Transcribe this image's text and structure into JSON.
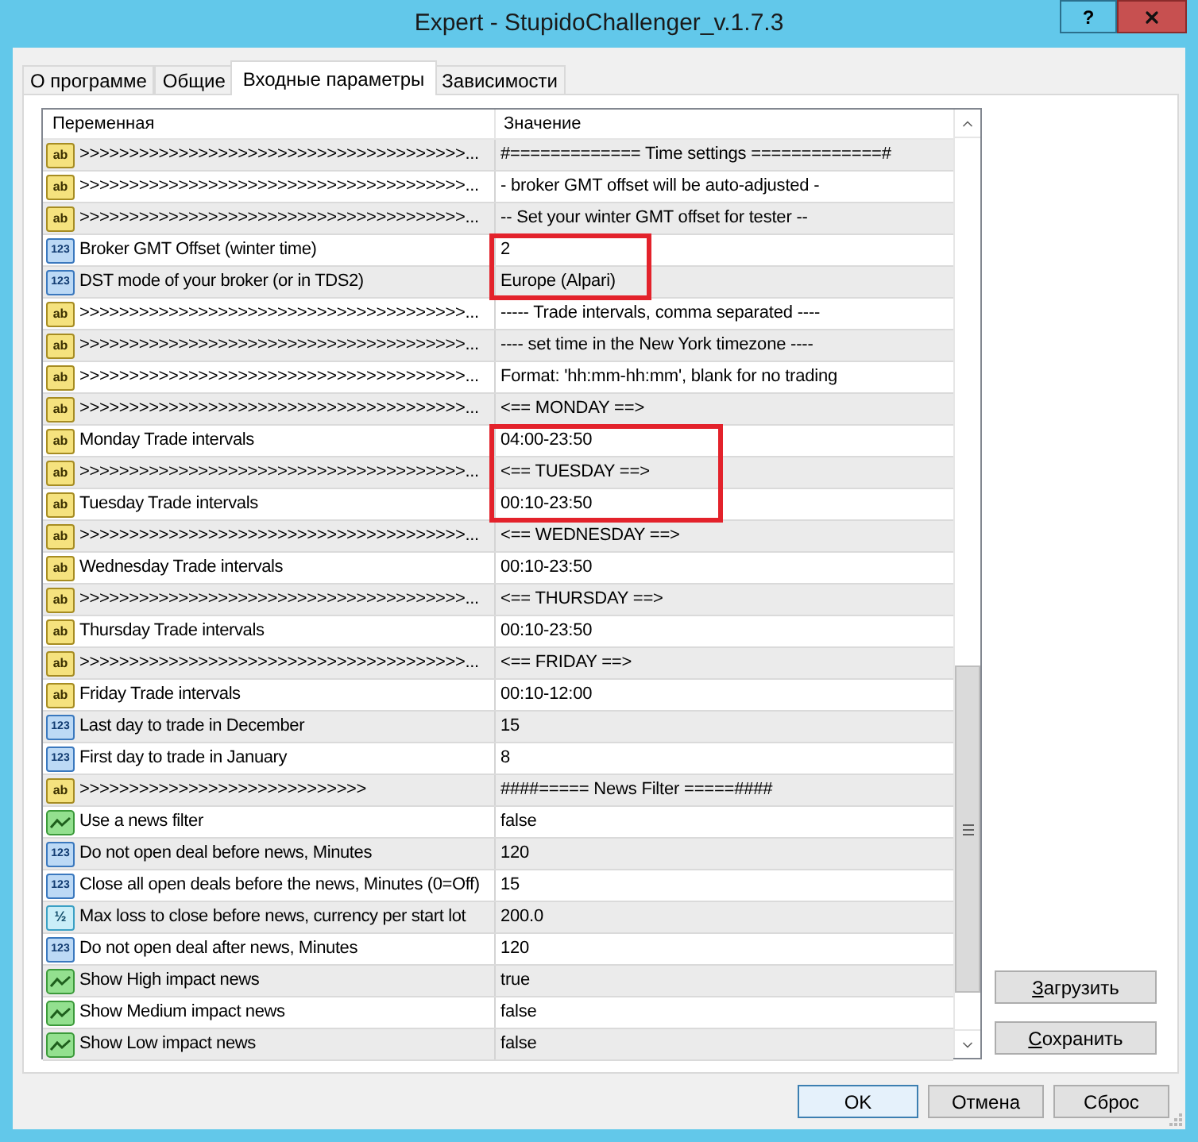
{
  "window": {
    "title": "Expert - StupidoChallenger_v.1.7.3",
    "help_button": "?"
  },
  "tabs": [
    {
      "label": "О программе",
      "selected": false
    },
    {
      "label": "Общие",
      "selected": false
    },
    {
      "label": "Входные параметры",
      "selected": true
    },
    {
      "label": "Зависимости",
      "selected": false
    }
  ],
  "table": {
    "columns": [
      "Переменная",
      "Значение"
    ],
    "rows": [
      {
        "kind": "string",
        "type_label": "ab",
        "name": ">>>>>>>>>>>>>>>>>>>>>>>>>>>>>>>>>>>>>>>...",
        "value": "#============= Time settings =============#",
        "highlighted": false
      },
      {
        "kind": "string",
        "type_label": "ab",
        "name": ">>>>>>>>>>>>>>>>>>>>>>>>>>>>>>>>>>>>>>>...",
        "value": "- broker GMT offset will be auto-adjusted -",
        "highlighted": false
      },
      {
        "kind": "string",
        "type_label": "ab",
        "name": ">>>>>>>>>>>>>>>>>>>>>>>>>>>>>>>>>>>>>>>...",
        "value": "-- Set your winter GMT offset for tester --",
        "highlighted": false
      },
      {
        "kind": "int",
        "type_label": "123",
        "name": "Broker GMT Offset (winter time)",
        "value": "2",
        "highlighted": true
      },
      {
        "kind": "int",
        "type_label": "123",
        "name": "DST mode of your broker (or in TDS2)",
        "value": "Europe (Alpari)",
        "highlighted": true
      },
      {
        "kind": "string",
        "type_label": "ab",
        "name": ">>>>>>>>>>>>>>>>>>>>>>>>>>>>>>>>>>>>>>>...",
        "value": "----- Trade intervals, comma separated ----",
        "highlighted": false
      },
      {
        "kind": "string",
        "type_label": "ab",
        "name": ">>>>>>>>>>>>>>>>>>>>>>>>>>>>>>>>>>>>>>>...",
        "value": "---- set time in the New York timezone ----",
        "highlighted": false
      },
      {
        "kind": "string",
        "type_label": "ab",
        "name": ">>>>>>>>>>>>>>>>>>>>>>>>>>>>>>>>>>>>>>>...",
        "value": "Format: 'hh:mm-hh:mm', blank for no trading",
        "highlighted": false
      },
      {
        "kind": "string",
        "type_label": "ab",
        "name": ">>>>>>>>>>>>>>>>>>>>>>>>>>>>>>>>>>>>>>>...",
        "value": "<== MONDAY ==>",
        "highlighted": false
      },
      {
        "kind": "string",
        "type_label": "ab",
        "name": "Monday Trade intervals",
        "value": "04:00-23:50",
        "highlighted": true
      },
      {
        "kind": "string",
        "type_label": "ab",
        "name": ">>>>>>>>>>>>>>>>>>>>>>>>>>>>>>>>>>>>>>>...",
        "value": "<== TUESDAY ==>",
        "highlighted": true
      },
      {
        "kind": "string",
        "type_label": "ab",
        "name": "Tuesday Trade intervals",
        "value": "00:10-23:50",
        "highlighted": true
      },
      {
        "kind": "string",
        "type_label": "ab",
        "name": ">>>>>>>>>>>>>>>>>>>>>>>>>>>>>>>>>>>>>>>...",
        "value": "<== WEDNESDAY ==>",
        "highlighted": false
      },
      {
        "kind": "string",
        "type_label": "ab",
        "name": "Wednesday Trade intervals",
        "value": "00:10-23:50",
        "highlighted": false
      },
      {
        "kind": "string",
        "type_label": "ab",
        "name": ">>>>>>>>>>>>>>>>>>>>>>>>>>>>>>>>>>>>>>>...",
        "value": "<== THURSDAY ==>",
        "highlighted": false
      },
      {
        "kind": "string",
        "type_label": "ab",
        "name": "Thursday Trade intervals",
        "value": "00:10-23:50",
        "highlighted": false
      },
      {
        "kind": "string",
        "type_label": "ab",
        "name": ">>>>>>>>>>>>>>>>>>>>>>>>>>>>>>>>>>>>>>>...",
        "value": "<== FRIDAY ==>",
        "highlighted": false
      },
      {
        "kind": "string",
        "type_label": "ab",
        "name": "Friday Trade intervals",
        "value": "00:10-12:00",
        "highlighted": false
      },
      {
        "kind": "int",
        "type_label": "123",
        "name": "Last day to trade in December",
        "value": "15",
        "highlighted": false
      },
      {
        "kind": "int",
        "type_label": "123",
        "name": "First day to trade in January",
        "value": "8",
        "highlighted": false
      },
      {
        "kind": "string",
        "type_label": "ab",
        "name": ">>>>>>>>>>>>>>>>>>>>>>>>>>>>>",
        "value": "####===== News Filter =====####",
        "highlighted": false
      },
      {
        "kind": "bool",
        "name": "Use a news filter",
        "value": "false",
        "highlighted": false
      },
      {
        "kind": "int",
        "type_label": "123",
        "name": "Do not open deal before news, Minutes",
        "value": "120",
        "highlighted": false
      },
      {
        "kind": "int",
        "type_label": "123",
        "name": "Close all open deals before the news, Minutes (0=Off)",
        "value": "15",
        "highlighted": false
      },
      {
        "kind": "double",
        "type_label": "½",
        "name": "Max loss to close before news, currency per start lot",
        "value": "200.0",
        "highlighted": false
      },
      {
        "kind": "int",
        "type_label": "123",
        "name": "Do not open deal after news, Minutes",
        "value": "120",
        "highlighted": false
      },
      {
        "kind": "bool",
        "name": "Show High impact news",
        "value": "true",
        "highlighted": false
      },
      {
        "kind": "bool",
        "name": "Show Medium impact news",
        "value": "false",
        "highlighted": false
      },
      {
        "kind": "bool",
        "name": "Show Low impact news",
        "value": "false",
        "highlighted": false
      }
    ]
  },
  "side_buttons": [
    {
      "label": "Загрузить",
      "mnemonic_underlined": true
    },
    {
      "label": "Сохранить",
      "mnemonic_underlined": true
    }
  ],
  "dialog_buttons": [
    {
      "label": "OK",
      "default": true
    },
    {
      "label": "Отмена",
      "default": false
    },
    {
      "label": "Сброс",
      "default": false
    }
  ]
}
